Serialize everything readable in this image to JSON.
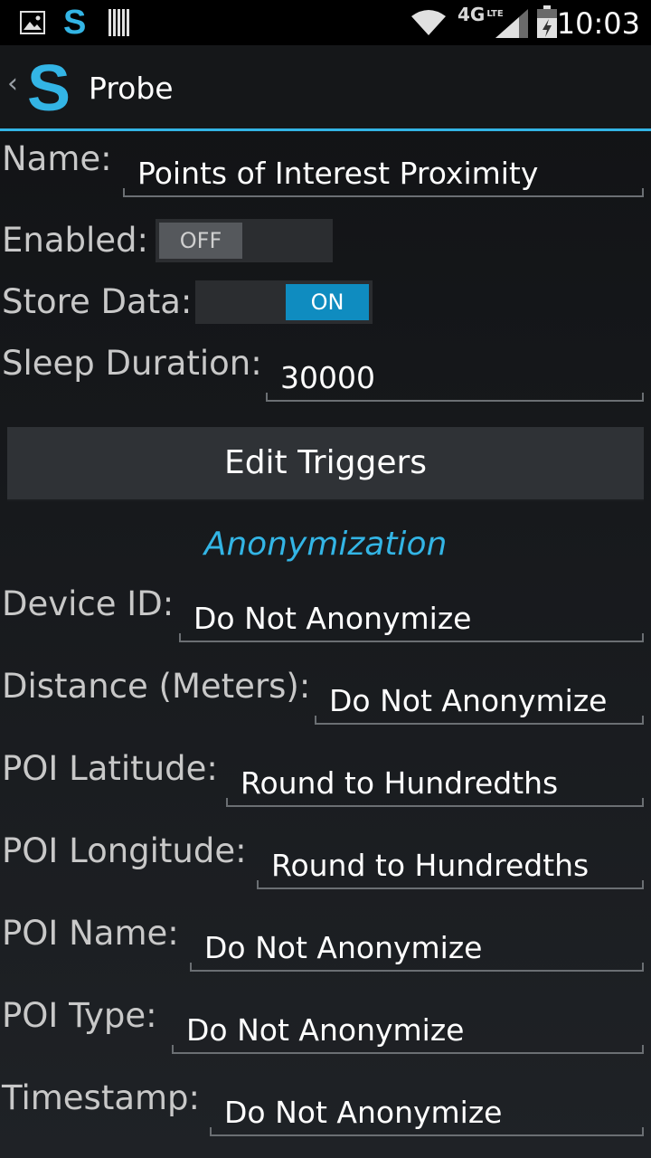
{
  "status_bar": {
    "time": "10:03",
    "network": "4G",
    "network_sub": "LTE",
    "icons": [
      "gallery-icon",
      "app-s-icon",
      "barcode-icon",
      "wifi-icon",
      "signal-icon",
      "battery-icon"
    ]
  },
  "action_bar": {
    "logo_text": "S",
    "title": "Probe"
  },
  "form": {
    "name_label": "Name:",
    "name_value": "Points of Interest Proximity",
    "enabled_label": "Enabled:",
    "enabled_state": "OFF",
    "store_label": "Store Data:",
    "store_state": "ON",
    "sleep_label": "Sleep Duration:",
    "sleep_value": "30000"
  },
  "edit_triggers_label": "Edit Triggers",
  "anonymization": {
    "title": "Anonymization",
    "rows": [
      {
        "label": "Device ID:",
        "value": "Do Not Anonymize"
      },
      {
        "label": "Distance (Meters):",
        "value": "Do Not Anonymize"
      },
      {
        "label": "POI Latitude:",
        "value": "Round to Hundredths"
      },
      {
        "label": "POI Longitude:",
        "value": "Round to Hundredths"
      },
      {
        "label": "POI Name:",
        "value": "Do Not Anonymize"
      },
      {
        "label": "POI Type:",
        "value": "Do Not Anonymize"
      },
      {
        "label": "Timestamp:",
        "value": "Do Not Anonymize"
      }
    ]
  },
  "colors": {
    "accent": "#33b5e5",
    "toggle_on": "#0f8cc0"
  }
}
